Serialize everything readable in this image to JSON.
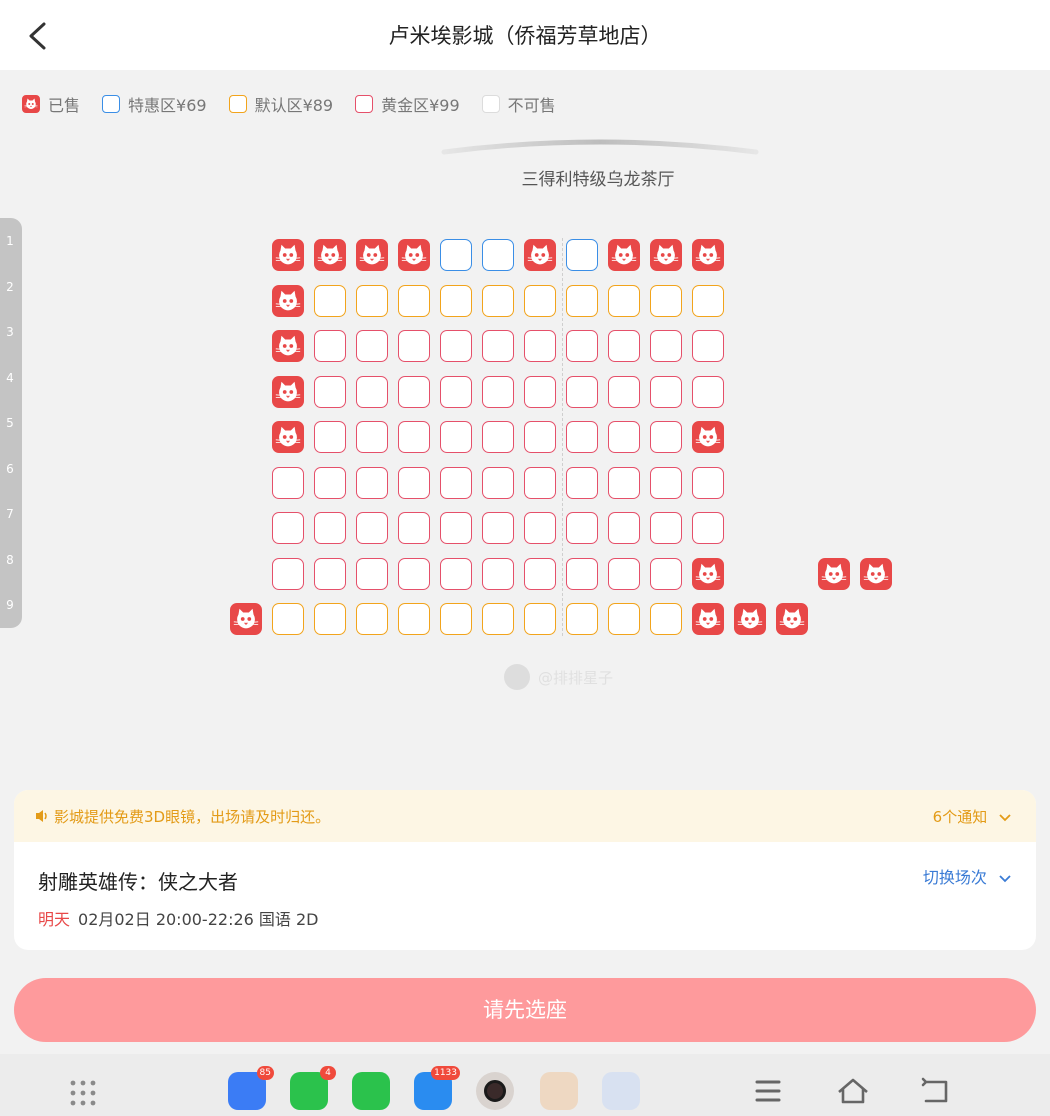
{
  "header": {
    "title": "卢米埃影城（侨福芳草地店）"
  },
  "legend": [
    {
      "label": "已售",
      "type": "sold"
    },
    {
      "label": "特惠区¥69",
      "type": "tehui",
      "color": "#3a8ee6"
    },
    {
      "label": "默认区¥89",
      "type": "moren",
      "color": "#f2a41c"
    },
    {
      "label": "黄金区¥99",
      "type": "huangjin",
      "color": "#e5506a"
    },
    {
      "label": "不可售",
      "type": "unavailable",
      "color": "#dcdcdc"
    }
  ],
  "hall_name": "三得利特级乌龙茶厅",
  "row_numbers": [
    "1",
    "2",
    "3",
    "4",
    "5",
    "6",
    "7",
    "8",
    "9"
  ],
  "seat_rows": [
    {
      "row": "1",
      "seats": [
        {
          "col": 1,
          "status": "sold"
        },
        {
          "col": 2,
          "status": "sold"
        },
        {
          "col": 3,
          "status": "sold"
        },
        {
          "col": 4,
          "status": "sold"
        },
        {
          "col": 5,
          "status": "tehui"
        },
        {
          "col": 6,
          "status": "tehui"
        },
        {
          "col": 7,
          "status": "sold"
        },
        {
          "col": 8,
          "status": "tehui"
        },
        {
          "col": 9,
          "status": "sold"
        },
        {
          "col": 10,
          "status": "sold"
        },
        {
          "col": 11,
          "status": "sold"
        }
      ]
    },
    {
      "row": "2",
      "seats": [
        {
          "col": 1,
          "status": "sold"
        },
        {
          "col": 2,
          "status": "moren"
        },
        {
          "col": 3,
          "status": "moren"
        },
        {
          "col": 4,
          "status": "moren"
        },
        {
          "col": 5,
          "status": "moren"
        },
        {
          "col": 6,
          "status": "moren"
        },
        {
          "col": 7,
          "status": "moren"
        },
        {
          "col": 8,
          "status": "moren"
        },
        {
          "col": 9,
          "status": "moren"
        },
        {
          "col": 10,
          "status": "moren"
        },
        {
          "col": 11,
          "status": "moren"
        }
      ]
    },
    {
      "row": "3",
      "seats": [
        {
          "col": 1,
          "status": "sold"
        },
        {
          "col": 2,
          "status": "huangjin"
        },
        {
          "col": 3,
          "status": "huangjin"
        },
        {
          "col": 4,
          "status": "huangjin"
        },
        {
          "col": 5,
          "status": "huangjin"
        },
        {
          "col": 6,
          "status": "huangjin"
        },
        {
          "col": 7,
          "status": "huangjin"
        },
        {
          "col": 8,
          "status": "huangjin"
        },
        {
          "col": 9,
          "status": "huangjin"
        },
        {
          "col": 10,
          "status": "huangjin"
        },
        {
          "col": 11,
          "status": "huangjin"
        }
      ]
    },
    {
      "row": "4",
      "seats": [
        {
          "col": 1,
          "status": "sold"
        },
        {
          "col": 2,
          "status": "huangjin"
        },
        {
          "col": 3,
          "status": "huangjin"
        },
        {
          "col": 4,
          "status": "huangjin"
        },
        {
          "col": 5,
          "status": "huangjin"
        },
        {
          "col": 6,
          "status": "huangjin"
        },
        {
          "col": 7,
          "status": "huangjin"
        },
        {
          "col": 8,
          "status": "huangjin"
        },
        {
          "col": 9,
          "status": "huangjin"
        },
        {
          "col": 10,
          "status": "huangjin"
        },
        {
          "col": 11,
          "status": "huangjin"
        }
      ]
    },
    {
      "row": "5",
      "seats": [
        {
          "col": 1,
          "status": "sold"
        },
        {
          "col": 2,
          "status": "huangjin"
        },
        {
          "col": 3,
          "status": "huangjin"
        },
        {
          "col": 4,
          "status": "huangjin"
        },
        {
          "col": 5,
          "status": "huangjin"
        },
        {
          "col": 6,
          "status": "huangjin"
        },
        {
          "col": 7,
          "status": "huangjin"
        },
        {
          "col": 8,
          "status": "huangjin"
        },
        {
          "col": 9,
          "status": "huangjin"
        },
        {
          "col": 10,
          "status": "huangjin"
        },
        {
          "col": 11,
          "status": "sold"
        }
      ]
    },
    {
      "row": "6",
      "seats": [
        {
          "col": 1,
          "status": "huangjin"
        },
        {
          "col": 2,
          "status": "huangjin"
        },
        {
          "col": 3,
          "status": "huangjin"
        },
        {
          "col": 4,
          "status": "huangjin"
        },
        {
          "col": 5,
          "status": "huangjin"
        },
        {
          "col": 6,
          "status": "huangjin"
        },
        {
          "col": 7,
          "status": "huangjin"
        },
        {
          "col": 8,
          "status": "huangjin"
        },
        {
          "col": 9,
          "status": "huangjin"
        },
        {
          "col": 10,
          "status": "huangjin"
        },
        {
          "col": 11,
          "status": "huangjin"
        }
      ]
    },
    {
      "row": "7",
      "seats": [
        {
          "col": 1,
          "status": "huangjin"
        },
        {
          "col": 2,
          "status": "huangjin"
        },
        {
          "col": 3,
          "status": "huangjin"
        },
        {
          "col": 4,
          "status": "huangjin"
        },
        {
          "col": 5,
          "status": "huangjin"
        },
        {
          "col": 6,
          "status": "huangjin"
        },
        {
          "col": 7,
          "status": "huangjin"
        },
        {
          "col": 8,
          "status": "huangjin"
        },
        {
          "col": 9,
          "status": "huangjin"
        },
        {
          "col": 10,
          "status": "huangjin"
        },
        {
          "col": 11,
          "status": "huangjin"
        }
      ]
    },
    {
      "row": "8",
      "seats": [
        {
          "col": 1,
          "status": "huangjin"
        },
        {
          "col": 2,
          "status": "huangjin"
        },
        {
          "col": 3,
          "status": "huangjin"
        },
        {
          "col": 4,
          "status": "huangjin"
        },
        {
          "col": 5,
          "status": "huangjin"
        },
        {
          "col": 6,
          "status": "huangjin"
        },
        {
          "col": 7,
          "status": "huangjin"
        },
        {
          "col": 8,
          "status": "huangjin"
        },
        {
          "col": 9,
          "status": "huangjin"
        },
        {
          "col": 10,
          "status": "huangjin"
        },
        {
          "col": 11,
          "status": "sold"
        },
        {
          "col": 14,
          "status": "sold"
        },
        {
          "col": 15,
          "status": "sold"
        }
      ]
    },
    {
      "row": "9",
      "seats": [
        {
          "col": 0,
          "status": "sold"
        },
        {
          "col": 1,
          "status": "moren"
        },
        {
          "col": 2,
          "status": "moren"
        },
        {
          "col": 3,
          "status": "moren"
        },
        {
          "col": 4,
          "status": "moren"
        },
        {
          "col": 5,
          "status": "moren"
        },
        {
          "col": 6,
          "status": "moren"
        },
        {
          "col": 7,
          "status": "moren"
        },
        {
          "col": 8,
          "status": "moren"
        },
        {
          "col": 9,
          "status": "moren"
        },
        {
          "col": 10,
          "status": "moren"
        },
        {
          "col": 11,
          "status": "sold"
        },
        {
          "col": 12,
          "status": "sold"
        },
        {
          "col": 13,
          "status": "sold"
        }
      ]
    }
  ],
  "watermark_text": "@排排星子",
  "notice": {
    "text": "影城提供免费3D眼镜，出场请及时归还。",
    "count_label": "6个通知"
  },
  "movie": {
    "title": "射雕英雄传：侠之大者",
    "switch_label": "切换场次",
    "day": "明天",
    "session": "02月02日 20:00-22:26 国语 2D"
  },
  "submit_label": "请先选座",
  "navbar": {
    "apps": [
      {
        "name": "feishu-app-icon",
        "badge": "85",
        "color": "#3b7cf5"
      },
      {
        "name": "wechat-app-icon",
        "badge": "4",
        "color": "#2bc24c"
      },
      {
        "name": "phone-app-icon",
        "badge": "",
        "color": "#2bc24c"
      },
      {
        "name": "messages-app-icon",
        "badge": "1133",
        "color": "#2a8cf0"
      },
      {
        "name": "camera-app-icon",
        "badge": "",
        "color": "#222222"
      },
      {
        "name": "weibo-app-icon",
        "badge": "",
        "color": "#f0c9a0"
      },
      {
        "name": "baidu-app-icon",
        "badge": "",
        "color": "#c8d8f5"
      }
    ]
  },
  "colors": {
    "sold": "#e84848",
    "tehui": "#3a8ee6",
    "moren": "#f2a41c",
    "huangjin": "#e5506a",
    "accent": "#fe9a9c"
  }
}
